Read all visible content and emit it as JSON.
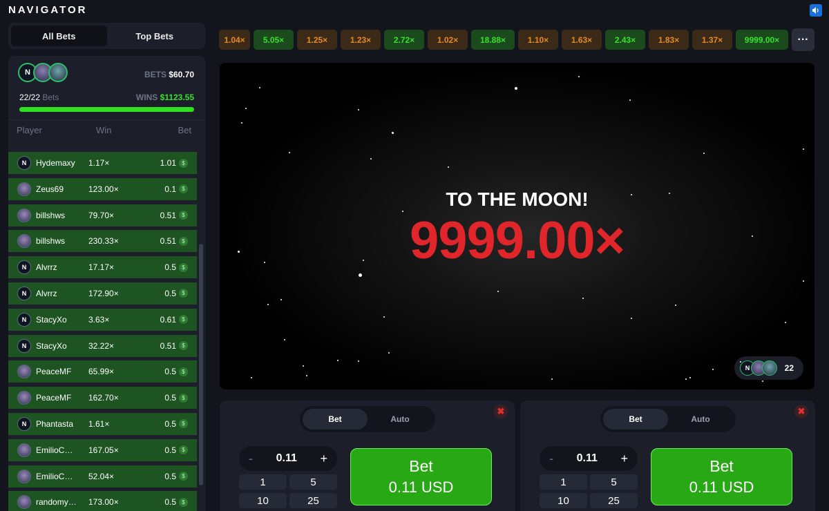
{
  "app": {
    "title": "NAVIGATOR"
  },
  "left_tabs": [
    "All Bets",
    "Top Bets"
  ],
  "summary": {
    "bets_label": "BETS",
    "bets_value": "$60.70",
    "count": "22/22",
    "count_label": "Bets",
    "wins_label": "WINS",
    "wins_value": "$1123.55",
    "progress": 1.0
  },
  "list_headers": {
    "player": "Player",
    "win": "Win",
    "bet": "Bet"
  },
  "rows": [
    {
      "name": "Hydemaxy",
      "win": "1.17×",
      "bet": "1.01"
    },
    {
      "name": "Zeus69",
      "win": "123.00×",
      "bet": "0.1"
    },
    {
      "name": "billshws",
      "win": "79.70×",
      "bet": "0.51"
    },
    {
      "name": "billshws",
      "win": "230.33×",
      "bet": "0.51"
    },
    {
      "name": "Alvrrz",
      "win": "17.17×",
      "bet": "0.5"
    },
    {
      "name": "Alvrrz",
      "win": "172.90×",
      "bet": "0.5"
    },
    {
      "name": "StacyXo",
      "win": "3.63×",
      "bet": "0.61"
    },
    {
      "name": "StacyXo",
      "win": "32.22×",
      "bet": "0.51"
    },
    {
      "name": "PeaceMF",
      "win": "65.99×",
      "bet": "0.5"
    },
    {
      "name": "PeaceMF",
      "win": "162.70×",
      "bet": "0.5"
    },
    {
      "name": "Phantasta",
      "win": "1.61×",
      "bet": "0.5"
    },
    {
      "name": "EmilioC…",
      "win": "167.05×",
      "bet": "0.5"
    },
    {
      "name": "EmilioC…",
      "win": "52.04×",
      "bet": "0.5"
    },
    {
      "name": "randomy…",
      "win": "173.00×",
      "bet": "0.5"
    }
  ],
  "history": [
    {
      "value": "1.04×",
      "color": "orange"
    },
    {
      "value": "5.05×",
      "color": "green"
    },
    {
      "value": "1.25×",
      "color": "orange"
    },
    {
      "value": "1.23×",
      "color": "orange"
    },
    {
      "value": "2.72×",
      "color": "green"
    },
    {
      "value": "1.02×",
      "color": "orange"
    },
    {
      "value": "18.88×",
      "color": "green"
    },
    {
      "value": "1.10×",
      "color": "orange"
    },
    {
      "value": "1.63×",
      "color": "orange"
    },
    {
      "value": "2.43×",
      "color": "green"
    },
    {
      "value": "1.83×",
      "color": "orange"
    },
    {
      "value": "1.37×",
      "color": "orange"
    },
    {
      "value": "9999.00×",
      "color": "green"
    }
  ],
  "game": {
    "headline": "TO THE MOON!",
    "multiplier": "9999.00×",
    "players_count": "22"
  },
  "bet_panels": [
    {
      "tabs": [
        "Bet",
        "Auto"
      ],
      "amount": "0.11",
      "minus": "-",
      "plus": "+",
      "quick": [
        "1",
        "5",
        "10",
        "25"
      ],
      "button_line1": "Bet",
      "button_line2": "0.11 USD"
    },
    {
      "tabs": [
        "Bet",
        "Auto"
      ],
      "amount": "0.11",
      "minus": "-",
      "plus": "+",
      "quick": [
        "1",
        "5",
        "10",
        "25"
      ],
      "button_line1": "Bet",
      "button_line2": "0.11 USD"
    }
  ],
  "colors": {
    "win_green": "#38e02a",
    "crash_red": "#e0262a",
    "row_green": "#1e5422",
    "orange": "#e88a20"
  }
}
